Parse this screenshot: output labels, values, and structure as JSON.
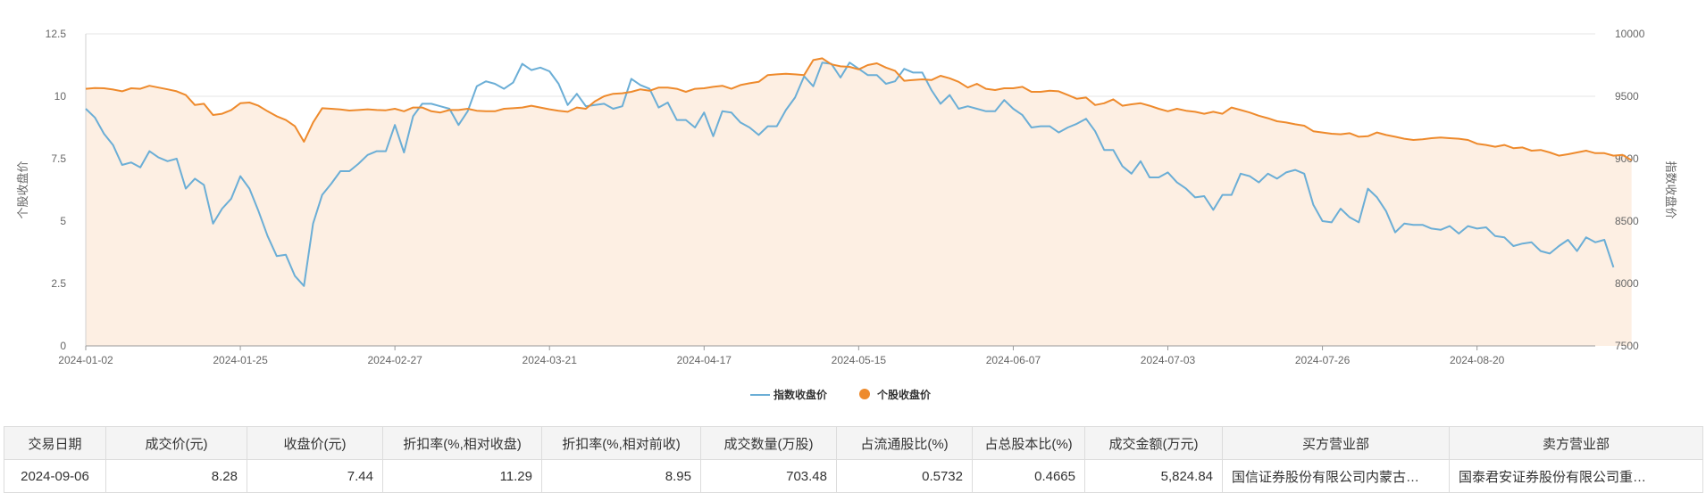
{
  "chart_data": {
    "type": "line",
    "x": [
      "2024-01-02",
      "2024-01-03",
      "2024-01-04",
      "2024-01-05",
      "2024-01-08",
      "2024-01-09",
      "2024-01-10",
      "2024-01-11",
      "2024-01-12",
      "2024-01-15",
      "2024-01-16",
      "2024-01-17",
      "2024-01-18",
      "2024-01-19",
      "2024-01-22",
      "2024-01-23",
      "2024-01-24",
      "2024-01-25",
      "2024-01-26",
      "2024-01-29",
      "2024-01-30",
      "2024-01-31",
      "2024-02-01",
      "2024-02-02",
      "2024-02-05",
      "2024-02-06",
      "2024-02-07",
      "2024-02-08",
      "2024-02-19",
      "2024-02-20",
      "2024-02-21",
      "2024-02-22",
      "2024-02-23",
      "2024-02-26",
      "2024-02-27",
      "2024-02-28",
      "2024-02-29",
      "2024-03-01",
      "2024-03-04",
      "2024-03-05",
      "2024-03-06",
      "2024-03-07",
      "2024-03-08",
      "2024-03-11",
      "2024-03-12",
      "2024-03-13",
      "2024-03-14",
      "2024-03-15",
      "2024-03-18",
      "2024-03-19",
      "2024-03-20",
      "2024-03-21",
      "2024-03-22",
      "2024-03-25",
      "2024-03-26",
      "2024-03-27",
      "2024-03-28",
      "2024-03-29",
      "2024-04-01",
      "2024-04-02",
      "2024-04-03",
      "2024-04-08",
      "2024-04-09",
      "2024-04-10",
      "2024-04-11",
      "2024-04-12",
      "2024-04-15",
      "2024-04-16",
      "2024-04-17",
      "2024-04-18",
      "2024-04-19",
      "2024-04-22",
      "2024-04-23",
      "2024-04-24",
      "2024-04-25",
      "2024-04-26",
      "2024-04-29",
      "2024-04-30",
      "2024-05-06",
      "2024-05-07",
      "2024-05-08",
      "2024-05-09",
      "2024-05-10",
      "2024-05-13",
      "2024-05-14",
      "2024-05-15",
      "2024-05-16",
      "2024-05-17",
      "2024-05-20",
      "2024-05-21",
      "2024-05-22",
      "2024-05-23",
      "2024-05-24",
      "2024-05-27",
      "2024-05-28",
      "2024-05-29",
      "2024-05-30",
      "2024-05-31",
      "2024-06-03",
      "2024-06-04",
      "2024-06-05",
      "2024-06-06",
      "2024-06-07",
      "2024-06-11",
      "2024-06-12",
      "2024-06-13",
      "2024-06-14",
      "2024-06-17",
      "2024-06-18",
      "2024-06-19",
      "2024-06-20",
      "2024-06-21",
      "2024-06-24",
      "2024-06-25",
      "2024-06-26",
      "2024-06-27",
      "2024-06-28",
      "2024-07-01",
      "2024-07-02",
      "2024-07-03",
      "2024-07-04",
      "2024-07-05",
      "2024-07-08",
      "2024-07-09",
      "2024-07-10",
      "2024-07-11",
      "2024-07-12",
      "2024-07-15",
      "2024-07-16",
      "2024-07-17",
      "2024-07-18",
      "2024-07-19",
      "2024-07-22",
      "2024-07-23",
      "2024-07-24",
      "2024-07-25",
      "2024-07-26",
      "2024-07-29",
      "2024-07-30",
      "2024-07-31",
      "2024-08-01",
      "2024-08-02",
      "2024-08-05",
      "2024-08-06",
      "2024-08-07",
      "2024-08-08",
      "2024-08-09",
      "2024-08-12",
      "2024-08-13",
      "2024-08-14",
      "2024-08-15",
      "2024-08-16",
      "2024-08-19",
      "2024-08-20",
      "2024-08-21",
      "2024-08-22",
      "2024-08-23",
      "2024-08-26",
      "2024-08-27",
      "2024-08-28",
      "2024-08-29",
      "2024-08-30",
      "2024-09-02",
      "2024-09-03",
      "2024-09-04",
      "2024-09-05",
      "2024-09-06"
    ],
    "x_ticks": [
      "2024-01-02",
      "2024-01-25",
      "2024-02-27",
      "2024-03-21",
      "2024-04-17",
      "2024-05-15",
      "2024-06-07",
      "2024-07-03",
      "2024-07-26",
      "2024-08-20"
    ],
    "y_left": {
      "label": "个股收盘价",
      "range": [
        0,
        12.5
      ],
      "ticks": [
        "0",
        "2.5",
        "5",
        "7.5",
        "10",
        "12.5"
      ]
    },
    "y_right": {
      "label": "指数收盘价",
      "range": [
        7500,
        10000
      ],
      "ticks": [
        "7500",
        "8000",
        "8500",
        "9000",
        "9500",
        "10000"
      ]
    },
    "grid": true,
    "legend_position": "bottom",
    "series": [
      {
        "name": "指数收盘价",
        "axis": "right",
        "color": "#6baed6",
        "values": [
          9400,
          9330,
          9200,
          9110,
          8950,
          8970,
          8930,
          9060,
          9010,
          8980,
          9000,
          8760,
          8840,
          8790,
          8480,
          8600,
          8680,
          8860,
          8760,
          8580,
          8380,
          8220,
          8230,
          8060,
          7980,
          8480,
          8710,
          8800,
          8900,
          8900,
          8960,
          9030,
          9060,
          9060,
          9270,
          9050,
          9340,
          9440,
          9440,
          9420,
          9400,
          9270,
          9380,
          9580,
          9620,
          9600,
          9560,
          9610,
          9760,
          9710,
          9730,
          9700,
          9600,
          9430,
          9520,
          9420,
          9430,
          9440,
          9400,
          9420,
          9640,
          9590,
          9560,
          9410,
          9450,
          9310,
          9310,
          9250,
          9370,
          9180,
          9380,
          9370,
          9290,
          9250,
          9190,
          9260,
          9260,
          9390,
          9490,
          9660,
          9580,
          9770,
          9760,
          9650,
          9770,
          9720,
          9670,
          9670,
          9600,
          9620,
          9720,
          9690,
          9690,
          9550,
          9440,
          9510,
          9400,
          9420,
          9400,
          9380,
          9380,
          9470,
          9400,
          9350,
          9250,
          9260,
          9260,
          9210,
          9250,
          9280,
          9320,
          9220,
          9070,
          9070,
          8940,
          8880,
          8980,
          8850,
          8850,
          8890,
          8810,
          8760,
          8690,
          8700,
          8590,
          8710,
          8710,
          8880,
          8860,
          8810,
          8880,
          8840,
          8890,
          8910,
          8880,
          8630,
          8500,
          8490,
          8600,
          8530,
          8490,
          8760,
          8690,
          8580,
          8410,
          8480,
          8470,
          8470,
          8440,
          8430,
          8460,
          8400,
          8460,
          8440,
          8450,
          8380,
          8370,
          8300,
          8320,
          8330,
          8260,
          8240,
          8300,
          8350,
          8260,
          8370,
          8330,
          8350,
          8130
        ]
      },
      {
        "name": "个股收盘价",
        "axis": "left",
        "color": "#ee8a2c",
        "fill": "#fdefe3",
        "values": [
          10.3,
          10.33,
          10.32,
          10.27,
          10.2,
          10.32,
          10.3,
          10.42,
          10.35,
          10.28,
          10.2,
          10.05,
          9.65,
          9.7,
          9.25,
          9.3,
          9.45,
          9.72,
          9.75,
          9.62,
          9.4,
          9.2,
          9.05,
          8.8,
          8.18,
          8.95,
          9.52,
          9.5,
          9.47,
          9.43,
          9.45,
          9.48,
          9.45,
          9.44,
          9.5,
          9.4,
          9.55,
          9.55,
          9.4,
          9.35,
          9.45,
          9.45,
          9.5,
          9.42,
          9.4,
          9.4,
          9.5,
          9.52,
          9.55,
          9.62,
          9.55,
          9.48,
          9.42,
          9.38,
          9.55,
          9.5,
          9.8,
          10.0,
          10.1,
          10.12,
          10.18,
          10.28,
          10.22,
          10.35,
          10.35,
          10.3,
          10.18,
          10.3,
          10.32,
          10.38,
          10.42,
          10.3,
          10.45,
          10.52,
          10.58,
          10.85,
          10.88,
          10.9,
          10.88,
          10.85,
          11.45,
          11.52,
          11.28,
          11.2,
          11.18,
          11.08,
          11.25,
          11.32,
          11.15,
          11.02,
          10.62,
          10.65,
          10.68,
          10.65,
          10.82,
          10.72,
          10.58,
          10.35,
          10.5,
          10.3,
          10.25,
          10.32,
          10.32,
          10.38,
          10.18,
          10.18,
          10.22,
          10.2,
          10.05,
          9.9,
          9.95,
          9.65,
          9.72,
          9.88,
          9.62,
          9.68,
          9.72,
          9.62,
          9.5,
          9.4,
          9.5,
          9.42,
          9.38,
          9.3,
          9.38,
          9.3,
          9.55,
          9.45,
          9.35,
          9.22,
          9.12,
          9.0,
          8.95,
          8.88,
          8.82,
          8.6,
          8.55,
          8.5,
          8.48,
          8.52,
          8.38,
          8.4,
          8.55,
          8.45,
          8.38,
          8.3,
          8.25,
          8.28,
          8.32,
          8.35,
          8.32,
          8.3,
          8.25,
          8.1,
          8.05,
          7.98,
          8.05,
          7.92,
          7.95,
          7.82,
          7.85,
          7.75,
          7.62,
          7.68,
          7.75,
          7.82,
          7.72,
          7.72,
          7.62,
          7.65,
          7.44
        ]
      }
    ]
  },
  "table": {
    "headers": [
      "交易日期",
      "成交价(元)",
      "收盘价(元)",
      "折扣率(%,相对收盘)",
      "折扣率(%,相对前收)",
      "成交数量(万股)",
      "占流通股比(%)",
      "占总股本比(%)",
      "成交金额(万元)",
      "买方营业部",
      "卖方营业部"
    ],
    "rows": [
      [
        "2024-09-06",
        "8.28",
        "7.44",
        "11.29",
        "8.95",
        "703.48",
        "0.5732",
        "0.4665",
        "5,824.84",
        "国信证券股份有限公司内蒙古…",
        "国泰君安证券股份有限公司重…"
      ]
    ]
  }
}
